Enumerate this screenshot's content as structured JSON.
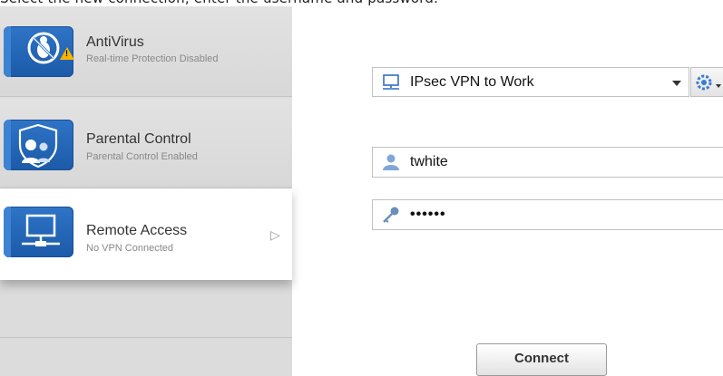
{
  "instruction_text": "Select the new connection, enter the username and password.",
  "sidebar": {
    "items": [
      {
        "title": "AntiVirus",
        "subtitle": "Real-time Protection Disabled",
        "icon": "antivirus-disabled-icon",
        "warning": "!"
      },
      {
        "title": "Parental Control",
        "subtitle": "Parental Control Enabled",
        "icon": "parental-shield-icon"
      },
      {
        "title": "Remote Access",
        "subtitle": "No VPN Connected",
        "icon": "computer-network-icon",
        "chevron": "▷"
      }
    ]
  },
  "form": {
    "connection": "IPsec VPN to Work",
    "username": "twhite",
    "password": "••••••",
    "connect_label": "Connect"
  },
  "colors": {
    "tile_blue": "#2266bb",
    "warning_yellow": "#f4b400"
  }
}
